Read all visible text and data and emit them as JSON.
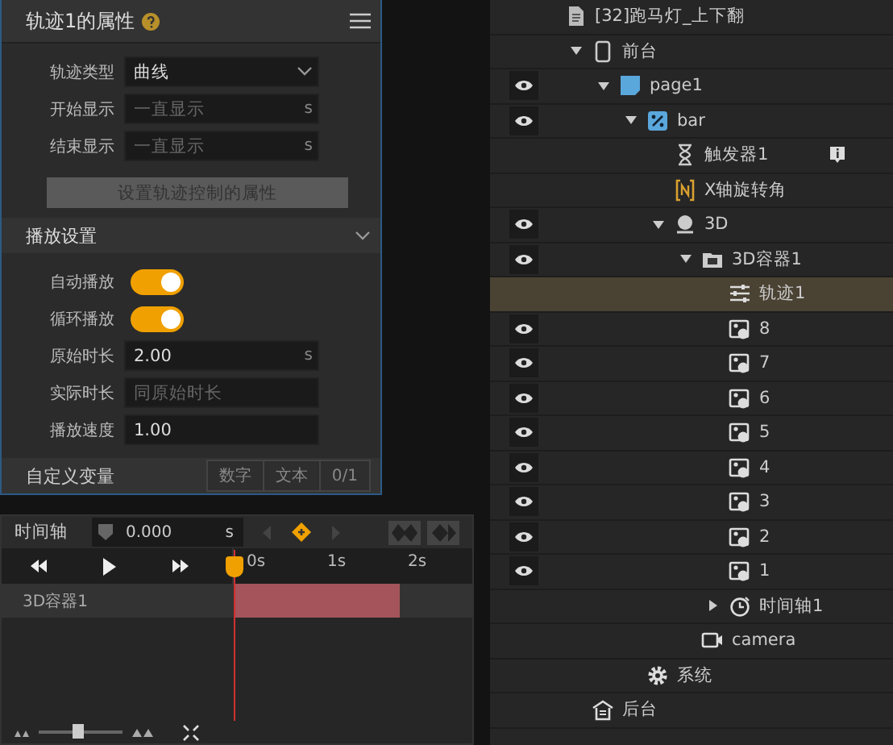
{
  "properties": {
    "title": "轨迹1的属性",
    "rows": [
      {
        "kind": "select",
        "label": "轨迹类型",
        "value": "曲线"
      },
      {
        "kind": "input",
        "label": "开始显示",
        "placeholder": "一直显示",
        "unit": "s"
      },
      {
        "kind": "input",
        "label": "结束显示",
        "placeholder": "一直显示",
        "unit": "s"
      }
    ],
    "action": "设置轨迹控制的属性"
  },
  "playback": {
    "title": "播放设置",
    "expanded": true,
    "rows": [
      {
        "kind": "toggle",
        "label": "自动播放",
        "on": true
      },
      {
        "kind": "toggle",
        "label": "循环播放",
        "on": true
      },
      {
        "kind": "input",
        "label": "原始时长",
        "value": "2.00",
        "unit": "s"
      },
      {
        "kind": "input",
        "label": "实际时长",
        "placeholder": "同原始时长"
      },
      {
        "kind": "input",
        "label": "播放速度",
        "value": "1.00"
      }
    ]
  },
  "variables": {
    "label": "自定义变量",
    "tabs": [
      "数字",
      "文本",
      "0/1"
    ]
  },
  "timeline": {
    "title": "时间轴",
    "time": "0.000",
    "unit": "s",
    "ticks": [
      "0s",
      "1s",
      "2s"
    ],
    "tracks": [
      {
        "label": "3D容器1"
      }
    ],
    "zoom": {
      "level": 0.47
    }
  },
  "tree": [
    {
      "label": "[32]跑马灯_上下翻",
      "kind": "document",
      "eye": false,
      "selected": false,
      "children": [
        {
          "label": "前台",
          "kind": "phone",
          "expanded": true,
          "eye": false,
          "selected": false,
          "children": [
            {
              "label": "page1",
              "kind": "page",
              "expanded": true,
              "eye": true,
              "selected": false,
              "children": [
                {
                  "label": "bar",
                  "kind": "percent",
                  "expanded": true,
                  "eye": true,
                  "selected": false,
                  "children": [
                    {
                      "label": "触发器1",
                      "kind": "hourglass",
                      "info": true,
                      "eye": false,
                      "selected": false
                    },
                    {
                      "label": "X轴旋转角",
                      "kind": "bracket",
                      "eye": false,
                      "selected": false
                    },
                    {
                      "label": "3D",
                      "kind": "ball",
                      "expanded": true,
                      "eye": true,
                      "selected": false,
                      "children": [
                        {
                          "label": "3D容器1",
                          "kind": "folder",
                          "expanded": true,
                          "eye": true,
                          "selected": false,
                          "children": [
                            {
                              "label": "轨迹1",
                              "kind": "sliders",
                              "eye": false,
                              "selected": true
                            },
                            {
                              "label": "8",
                              "kind": "image",
                              "eye": true,
                              "selected": false
                            },
                            {
                              "label": "7",
                              "kind": "image",
                              "eye": true,
                              "selected": false
                            },
                            {
                              "label": "6",
                              "kind": "image",
                              "eye": true,
                              "selected": false
                            },
                            {
                              "label": "5",
                              "kind": "image",
                              "eye": true,
                              "selected": false
                            },
                            {
                              "label": "4",
                              "kind": "image",
                              "eye": true,
                              "selected": false
                            },
                            {
                              "label": "3",
                              "kind": "image",
                              "eye": true,
                              "selected": false
                            },
                            {
                              "label": "2",
                              "kind": "image",
                              "eye": true,
                              "selected": false
                            },
                            {
                              "label": "1",
                              "kind": "image",
                              "eye": true,
                              "selected": false
                            },
                            {
                              "label": "时间轴1",
                              "kind": "clock",
                              "expanded": false,
                              "eye": false,
                              "selected": false
                            }
                          ]
                        },
                        {
                          "label": "camera",
                          "kind": "camera",
                          "eye": false,
                          "selected": false
                        }
                      ]
                    }
                  ]
                },
                {
                  "label": "系统",
                  "kind": "gear",
                  "eye": false,
                  "selected": false
                }
              ]
            }
          ]
        },
        {
          "label": "后台",
          "kind": "home",
          "eye": false,
          "selected": false
        }
      ]
    }
  ]
}
